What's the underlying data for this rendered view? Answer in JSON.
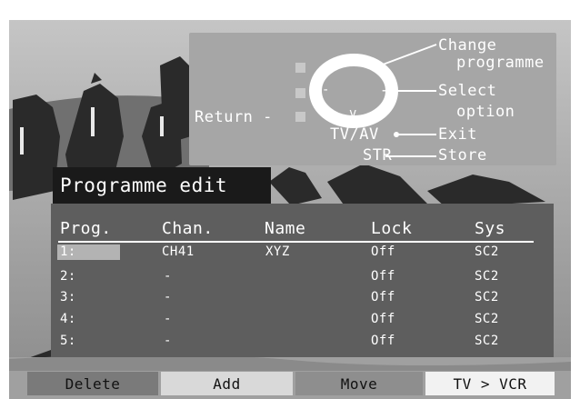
{
  "help": {
    "change_programme": [
      "Change",
      "programme"
    ],
    "select_option": [
      "Select",
      "option"
    ],
    "return_label": "Return -",
    "tvav_label": "TV/AV",
    "exit_label": "Exit",
    "str_label": "STR",
    "store_label": "Store",
    "glyphs": {
      "up": "^",
      "down": "v",
      "left": "-",
      "right": "+"
    }
  },
  "title": "Programme edit",
  "table": {
    "headers": [
      "Prog.",
      "Chan.",
      "Name",
      "Lock",
      "Sys"
    ],
    "rows": [
      {
        "prog": "1:",
        "chan": "CH41",
        "name": "XYZ",
        "lock": "Off",
        "sys": "SC2",
        "selected": true
      },
      {
        "prog": "2:",
        "chan": "-",
        "name": "",
        "lock": "Off",
        "sys": "SC2"
      },
      {
        "prog": "3:",
        "chan": "-",
        "name": "",
        "lock": "Off",
        "sys": "SC2"
      },
      {
        "prog": "4:",
        "chan": "-",
        "name": "",
        "lock": "Off",
        "sys": "SC2"
      },
      {
        "prog": "5:",
        "chan": "-",
        "name": "",
        "lock": "Off",
        "sys": "SC2"
      }
    ]
  },
  "buttons": {
    "delete": {
      "label": "Delete",
      "color": "#7a7a7a"
    },
    "add": {
      "label": "Add",
      "color": "#d9d9d9"
    },
    "move": {
      "label": "Move",
      "color": "#8e8e8e"
    },
    "tv_vcr": {
      "label": "TV > VCR",
      "color": "#f2f2f2"
    }
  }
}
